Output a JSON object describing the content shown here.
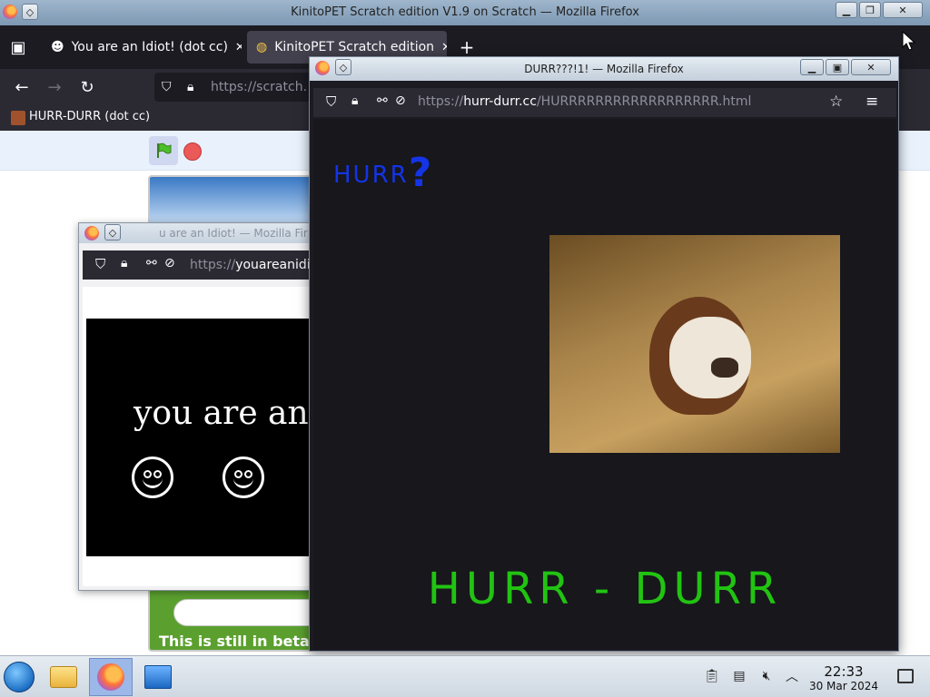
{
  "main_window": {
    "title": "KinitoPET Scratch edition V1.9 on Scratch — Mozilla Firefox",
    "tabs": [
      {
        "label": "You are an Idiot! (dot cc)",
        "close": "✕"
      },
      {
        "label": "KinitoPET Scratch edition",
        "close": "✕"
      }
    ],
    "new_tab": "+",
    "url": "https://scratch.",
    "bookmark": "HURR-DURR (dot cc)",
    "stage_footer": "This is still in beta."
  },
  "idiot_window": {
    "title": "u are an Idiot! — Mozilla Fir",
    "url_prefix": "https://",
    "url_host": "youareanidic",
    "text": "you are an idiot"
  },
  "durr_window": {
    "title": "DURR???!1! — Mozilla Firefox",
    "url_prefix": "https://",
    "url_host": "hurr-durr.cc",
    "url_path": "/HURRRRRRRRRRRRRRRRRR.html",
    "heading_word": "HURR",
    "heading_mark": "?",
    "big_text": "HURR - DURR"
  },
  "taskbar": {
    "time": "22:33",
    "date": "30 Mar 2024"
  },
  "colors": {
    "ff_dark": "#1c1b22",
    "hurr_blue": "#1434e6",
    "hurr_green": "#22c312"
  }
}
